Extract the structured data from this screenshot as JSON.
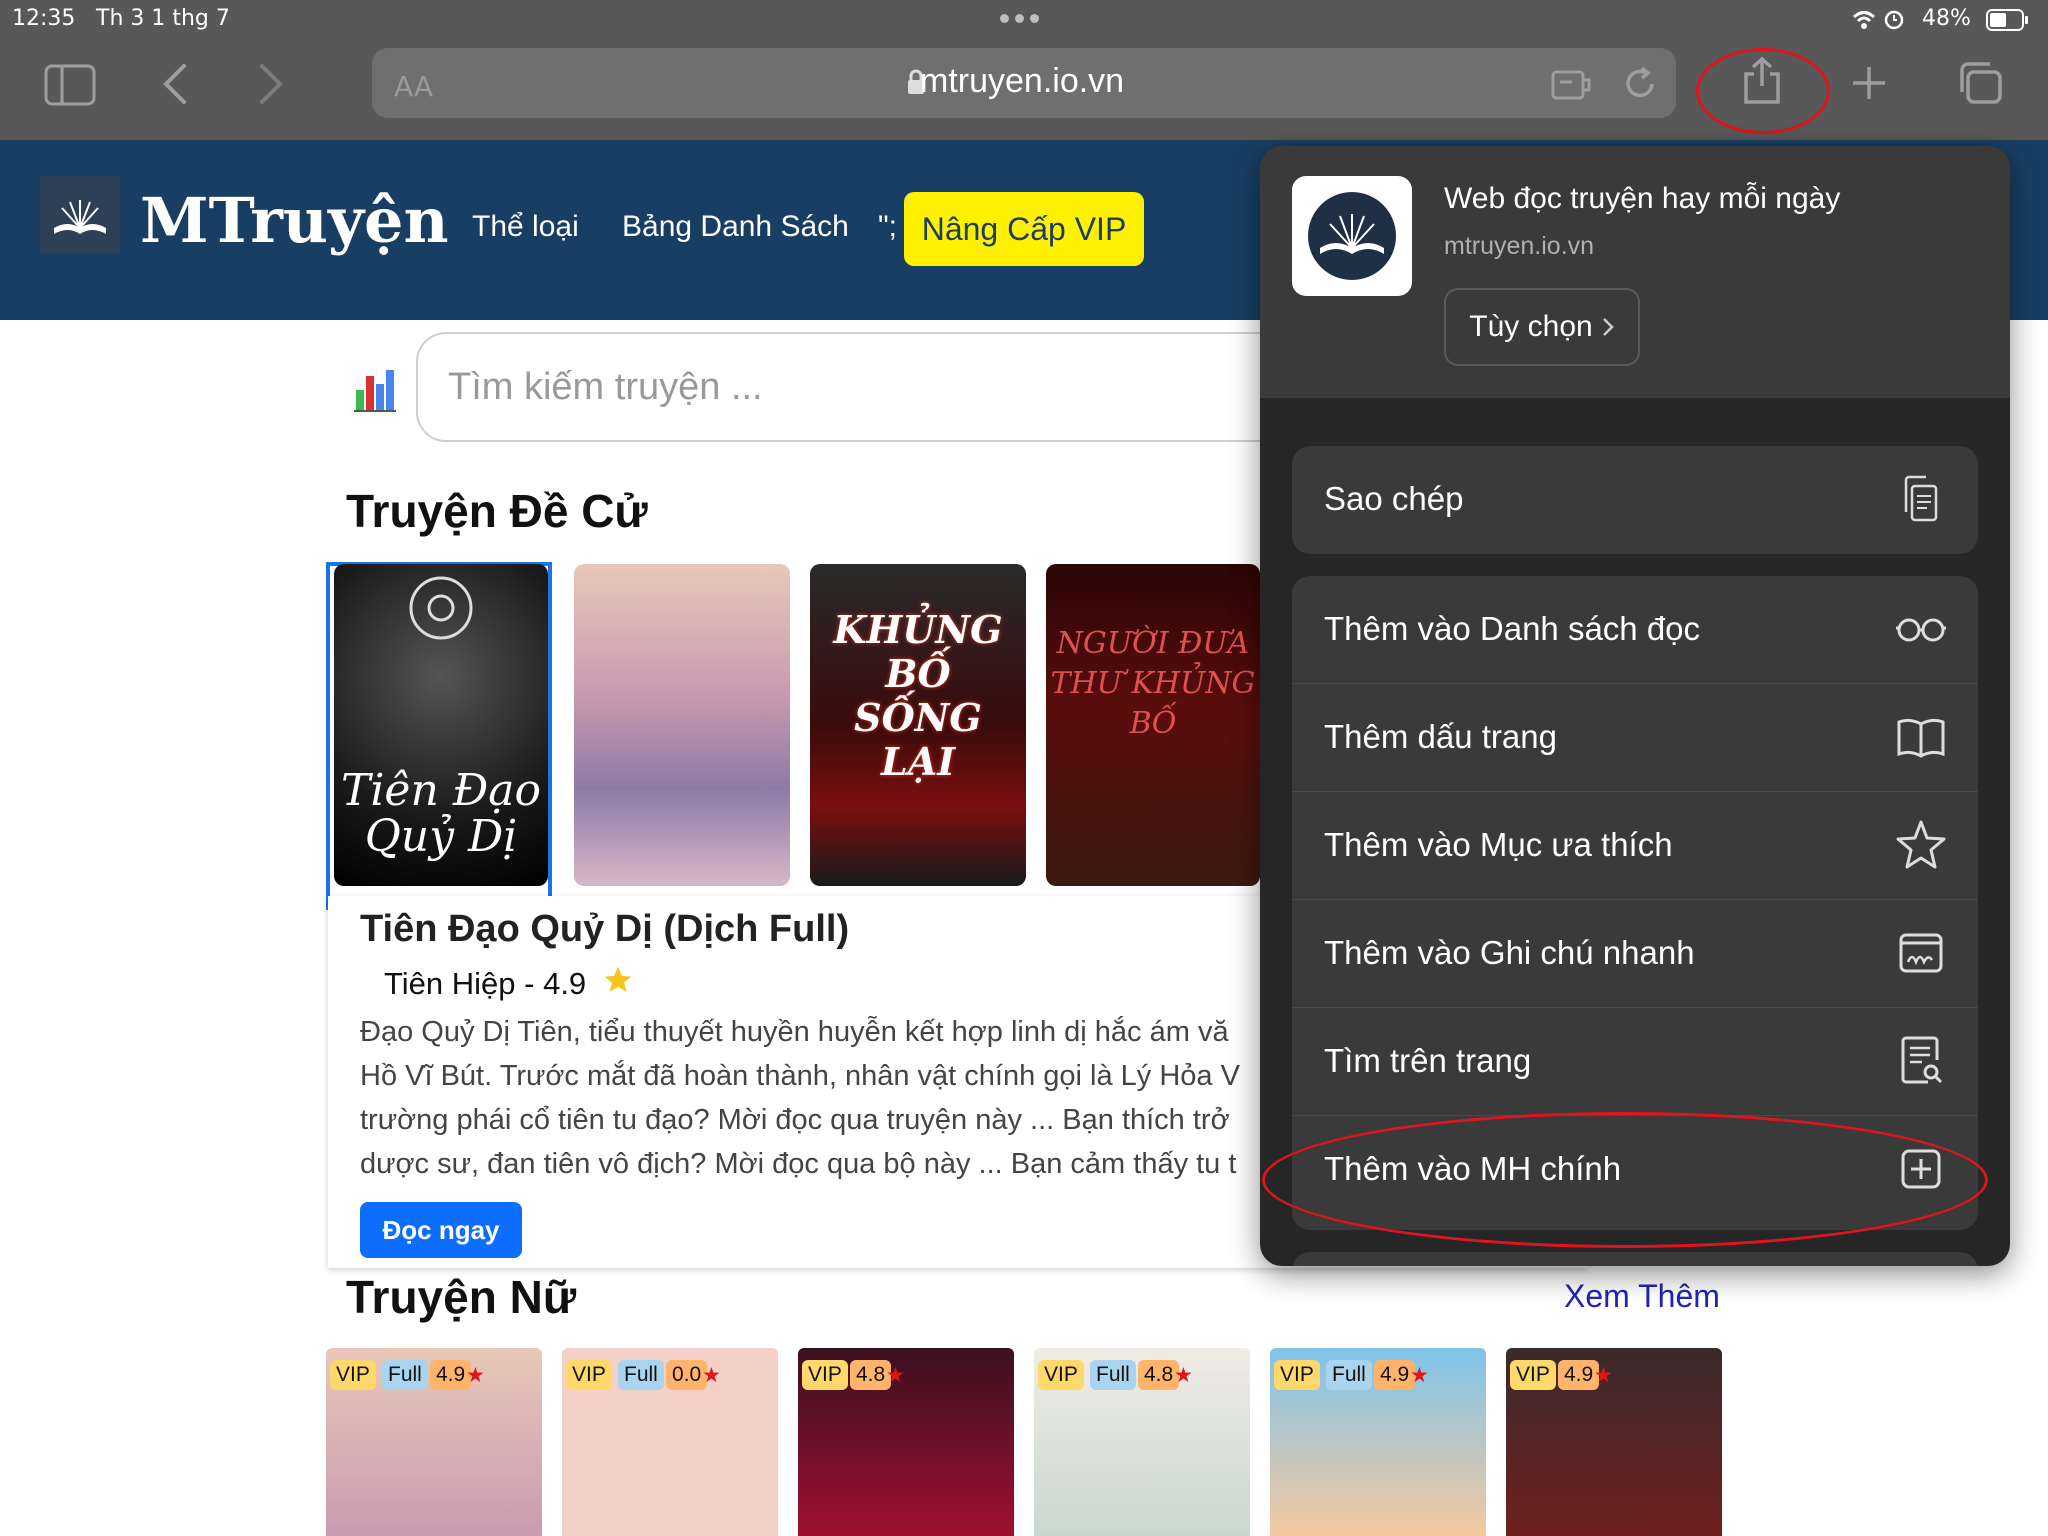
{
  "status": {
    "time": "12:35",
    "date": "Th 3 1 thg 7",
    "battery": "48%"
  },
  "browser": {
    "aa": "AA",
    "url": "mtruyen.io.vn"
  },
  "site": {
    "brand": "MTruyện",
    "nav": [
      "Thể loại",
      "Bảng Danh Sách",
      "\";",
      "Nâng Cấp VIP"
    ],
    "search_placeholder": "Tìm kiếm truyện ..."
  },
  "featured": {
    "section_title": "Truyện Đề Cử",
    "cover_texts": [
      "Tiên Đạo Quỷ Dị",
      "KHỦNG BỐ SỐNG LẠI",
      "NGƯỜI ĐƯA THƯ KHỦNG BỐ"
    ],
    "title": "Tiên Đạo Quỷ Dị (Dịch Full)",
    "meta": "Tiên Hiệp - 4.9",
    "description": [
      "Đạo Quỷ Dị Tiên, tiểu thuyết huyền huyễn kết hợp linh dị hắc ám vă",
      "Hồ Vĩ Bút. Trước mắt đã hoàn thành, nhân vật chính gọi là Lý Hỏa V",
      "trường phái cổ tiên tu đạo? Mời đọc qua truyện này ... Bạn thích trở",
      "dược sư, đan tiên vô địch? Mời đọc qua bộ này ... Bạn cảm thấy tu t"
    ],
    "read_label": "Đọc ngay"
  },
  "female_section": {
    "title": "Truyện Nữ",
    "see_more": "Xem Thêm",
    "items": [
      {
        "vip": "VIP",
        "full": "Full",
        "rating": "4.9"
      },
      {
        "vip": "VIP",
        "full": "Full",
        "rating": "0.0"
      },
      {
        "vip": "VIP",
        "full": "",
        "rating": "4.8"
      },
      {
        "vip": "VIP",
        "full": "Full",
        "rating": "4.8"
      },
      {
        "vip": "VIP",
        "full": "Full",
        "rating": "4.9"
      },
      {
        "vip": "VIP",
        "full": "",
        "rating": "4.9"
      }
    ]
  },
  "share_sheet": {
    "title": "Web đọc truyện hay mỗi ngày",
    "domain": "mtruyen.io.vn",
    "options_label": "Tùy chọn",
    "copy_label": "Sao chép",
    "actions": [
      {
        "label": "Thêm vào Danh sách đọc",
        "icon": "glasses-icon"
      },
      {
        "label": "Thêm dấu trang",
        "icon": "book-icon"
      },
      {
        "label": "Thêm vào Mục ưa thích",
        "icon": "star-icon"
      },
      {
        "label": "Thêm vào Ghi chú nhanh",
        "icon": "quick-note-icon"
      },
      {
        "label": "Tìm trên trang",
        "icon": "find-in-page-icon"
      },
      {
        "label": "Thêm vào MH chính",
        "icon": "add-square-icon"
      }
    ]
  },
  "colors": {
    "header_bg": "#183f63",
    "vip_yellow": "#fff200",
    "button_blue": "#0d6efd",
    "annotation_red": "#e0141b",
    "sheet_bg": "#262626"
  }
}
